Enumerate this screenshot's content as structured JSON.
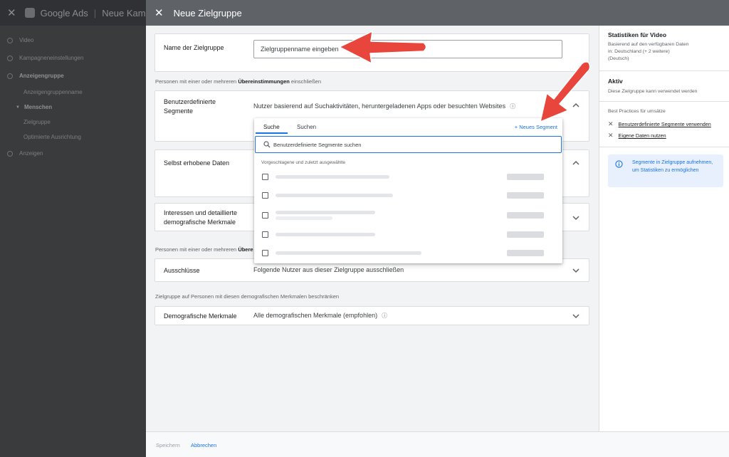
{
  "background": {
    "app_name": "Google Ads",
    "campaign_title": "Neue Kampa",
    "nav": [
      {
        "label": "Video"
      },
      {
        "label": "Kampagneneinstellungen"
      },
      {
        "label": "Anzeigengruppe"
      },
      {
        "label": "Anzeigengruppenname"
      },
      {
        "label": "Menschen"
      },
      {
        "label": "Zielgruppe"
      },
      {
        "label": "Optimierte Ausrichtung"
      },
      {
        "label": "Anzeigen"
      }
    ]
  },
  "modal": {
    "title": "Neue Zielgruppe",
    "name_card": {
      "label": "Name der Zielgruppe",
      "placeholder": "Zielgruppenname eingeben"
    },
    "include_section_pre": "Personen mit einer oder mehreren ",
    "include_section_bold": "Übereinstimmungen",
    "include_section_post": " einschließen",
    "custom_segments": {
      "label_line1": "Benutzerdefinierte",
      "label_line2": "Segmente",
      "value": "Nutzer basierend auf Suchaktivitäten, heruntergeladenen Apps oder besuchten Websites"
    },
    "own_data": {
      "label": "Selbst erhobene Daten"
    },
    "interests": {
      "label_line1": "Interessen und detaillierte",
      "label_line2": "demografische Merkmale"
    },
    "exclude_section_pre": "Personen mit einer oder mehreren ",
    "exclude_section_bold": "Übere",
    "exclusions": {
      "label": "Ausschlüsse",
      "value": "Folgende Nutzer aus dieser Zielgruppe ausschließen"
    },
    "demo_section": "Zielgruppe auf Personen mit diesen demografischen Merkmalen beschränken",
    "demographics": {
      "label": "Demografische Merkmale",
      "value": "Alle demografischen Merkmale (empfohlen)"
    },
    "dropdown": {
      "tabs": [
        {
          "label": "Suche"
        },
        {
          "label": "Suchen"
        }
      ],
      "new_segment": "+ Neues Segment",
      "search_placeholder": "Benutzerdefinierte Segmente suchen",
      "hint": "Vorgeschlagene und zuletzt ausgewählte"
    },
    "footer": {
      "save": "Speichern",
      "cancel": "Abbrechen"
    }
  },
  "right_panel": {
    "stats_title": "Statistiken für Video",
    "stats_line1": "Basierend auf den verfügbaren Daten",
    "stats_line2": "in: Deutschland (+ 2 weitere)",
    "stats_line3": "(Deutsch)",
    "status_title": "Aktiv",
    "status_text": "Diese Zielgruppe kann verwendet werden",
    "best_practices_title": "Best Practices für umsätze",
    "best_practices": [
      {
        "label": "Benutzerdefinierte Segmente verwenden"
      },
      {
        "label": "Eigene Daten nutzen"
      }
    ],
    "info": "Segmente in Zielgruppe aufnehmen, um Statistiken zu ermöglichen"
  },
  "colors": {
    "accent": "#1a73e8",
    "arrow": "#e8453c",
    "header": "#5f6368"
  }
}
